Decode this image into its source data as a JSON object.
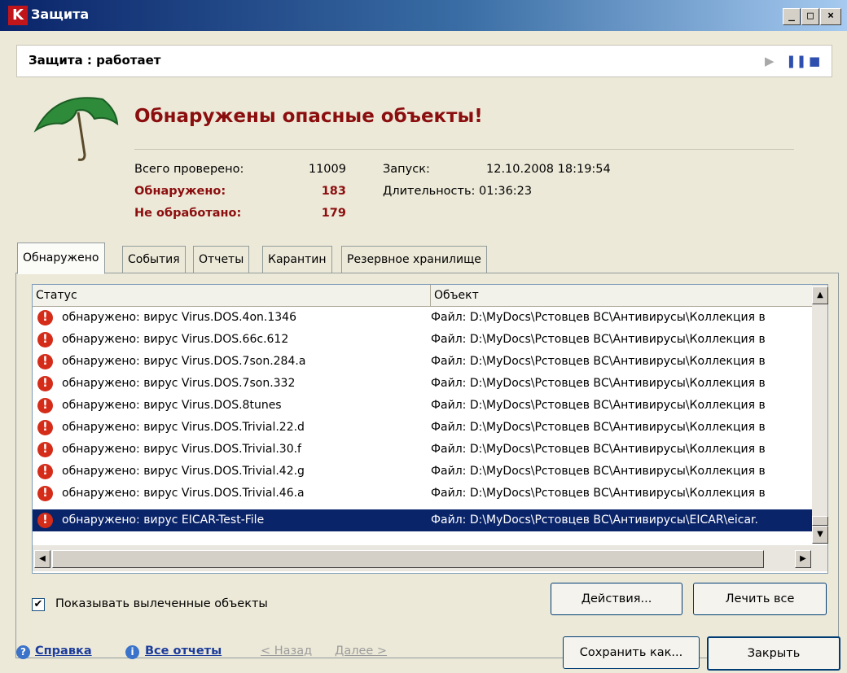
{
  "window": {
    "title": "Защита",
    "logo_letter": "K"
  },
  "status": {
    "text": "Защита : работает"
  },
  "header": {
    "heading": "Обнаружены опасные объекты!",
    "total_label": "Всего проверено:",
    "total_value": "11009",
    "found_label": "Обнаружено:",
    "found_value": "183",
    "unprocessed_label": "Не обработано:",
    "unprocessed_value": "179",
    "start_label": "Запуск:",
    "start_value": "12.10.2008 18:19:54",
    "duration_label": "Длительность: 01:36:23"
  },
  "tabs": [
    "Обнаружено",
    "События",
    "Отчеты",
    "Карантин",
    "Резервное хранилище"
  ],
  "list": {
    "columns": [
      "Статус",
      "Объект"
    ],
    "rows": [
      {
        "status": "обнаружено: вирус Virus.DOS.4on.1346",
        "object": "Файл: D:\\MyDocs\\Рстовцев ВС\\Антивирусы\\Коллекция в"
      },
      {
        "status": "обнаружено: вирус Virus.DOS.66c.612",
        "object": "Файл: D:\\MyDocs\\Рстовцев ВС\\Антивирусы\\Коллекция в"
      },
      {
        "status": "обнаружено: вирус Virus.DOS.7son.284.a",
        "object": "Файл: D:\\MyDocs\\Рстовцев ВС\\Антивирусы\\Коллекция в"
      },
      {
        "status": "обнаружено: вирус Virus.DOS.7son.332",
        "object": "Файл: D:\\MyDocs\\Рстовцев ВС\\Антивирусы\\Коллекция в"
      },
      {
        "status": "обнаружено: вирус Virus.DOS.8tunes",
        "object": "Файл: D:\\MyDocs\\Рстовцев ВС\\Антивирусы\\Коллекция в"
      },
      {
        "status": "обнаружено: вирус Virus.DOS.Trivial.22.d",
        "object": "Файл: D:\\MyDocs\\Рстовцев ВС\\Антивирусы\\Коллекция в"
      },
      {
        "status": "обнаружено: вирус Virus.DOS.Trivial.30.f",
        "object": "Файл: D:\\MyDocs\\Рстовцев ВС\\Антивирусы\\Коллекция в"
      },
      {
        "status": "обнаружено: вирус Virus.DOS.Trivial.42.g",
        "object": "Файл: D:\\MyDocs\\Рстовцев ВС\\Антивирусы\\Коллекция в"
      },
      {
        "status": "обнаружено: вирус Virus.DOS.Trivial.46.a",
        "object": "Файл: D:\\MyDocs\\Рстовцев ВС\\Антивирусы\\Коллекция в"
      },
      {
        "status": "обнаружено: вирус EICAR-Test-File",
        "object": "Файл: D:\\MyDocs\\Рстовцев ВС\\Антивирусы\\EICAR\\eicar.",
        "selected": true
      }
    ]
  },
  "checkbox": {
    "label": "Показывать вылеченные объекты",
    "checked": true
  },
  "buttons": {
    "actions": "Действия...",
    "cure_all": "Лечить все",
    "save_as": "Сохранить как...",
    "close": "Закрыть"
  },
  "footer": {
    "help": "Справка",
    "all_reports": "Все отчеты",
    "back": "< Назад",
    "next": "Далее >"
  },
  "colors": {
    "heading": "#8b0e0e",
    "selection": "#0a246a",
    "alert_icon": "#d42c19"
  }
}
